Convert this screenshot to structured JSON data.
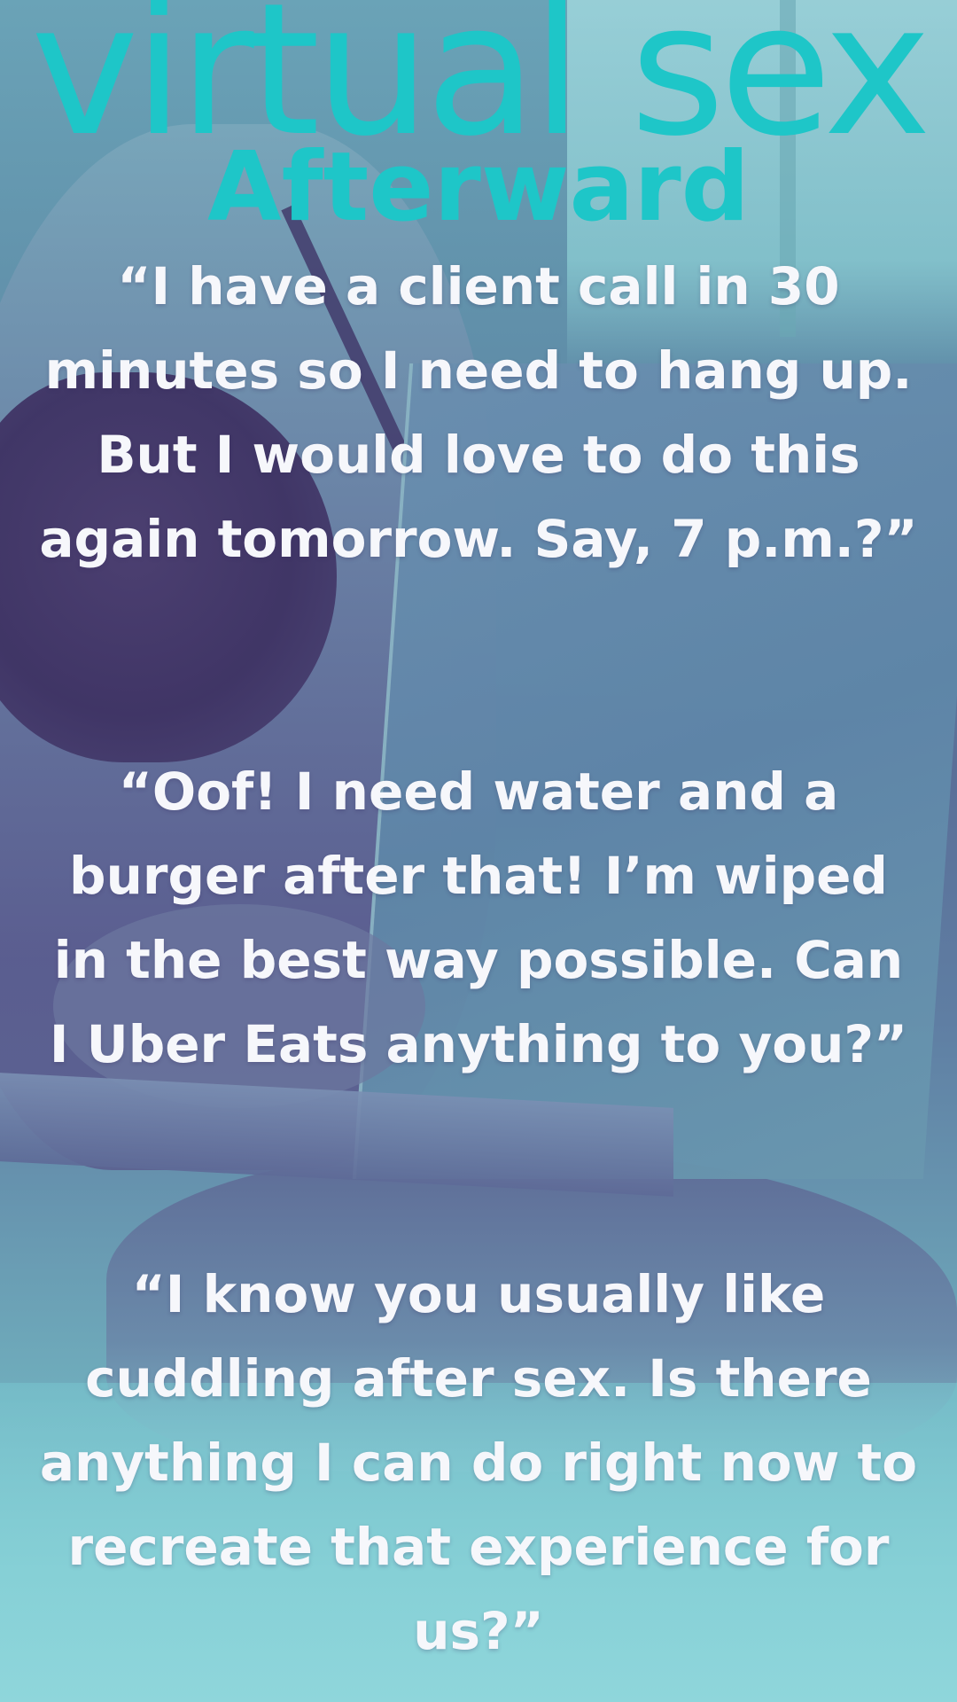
{
  "header": {
    "brand": "virtual sex",
    "subtitle": "Afterward"
  },
  "quotes": [
    "“I have a client call in 30 minutes so I need to hang up. But I would love to do this again tomorrow. Say, 7 p.m.?”",
    "“Oof! I need water and a burger after that! I’m wiped in the best way possible. Can I Uber Eats anything to you?”",
    "“I know you usually like cuddling after sex. Is there anything I can do right now to recreate that experience for us?”"
  ],
  "colors": {
    "title_teal": "#1ec6c8",
    "quote_text": "#f6f7fb",
    "overlay_violet": "#5a5a8e",
    "overlay_cyan": "#86d0d6"
  }
}
